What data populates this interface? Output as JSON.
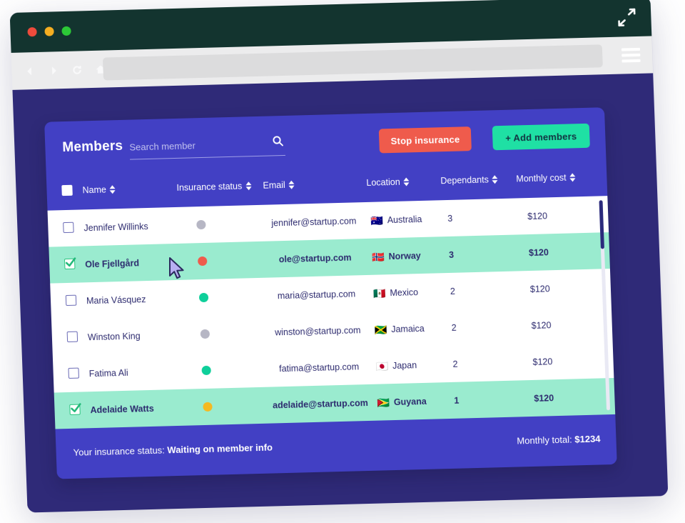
{
  "browser": {
    "traffic_lights": [
      "close-red",
      "minimize-yellow",
      "maximize-green"
    ],
    "expand_icon": "expand-arrows-icon",
    "nav": [
      "back-arrow-icon",
      "forward-arrow-icon",
      "reload-icon",
      "home-icon"
    ],
    "url_value": "",
    "url_placeholder": "",
    "menu_icon": "hamburger-menu-icon"
  },
  "app": {
    "title": "Members",
    "search": {
      "value": "",
      "placeholder": "Search member",
      "icon": "search-icon"
    },
    "buttons": {
      "stop": "Stop insurance",
      "add": "+ Add members"
    },
    "colors": {
      "card": "#4240c4",
      "page_bg": "#2f2a78",
      "titlebar": "#13342f",
      "stop_btn": "#ef5b4c",
      "add_btn": "#1fe0a4",
      "row_selected": "#9aebcf",
      "status_grey": "#b6b6c4",
      "status_red": "#ef5b4c",
      "status_green": "#0ecf9a",
      "status_amber": "#f5b921"
    }
  },
  "table": {
    "columns": [
      {
        "label": "Name",
        "sortable": true
      },
      {
        "label": "Insurance status",
        "sortable": true
      },
      {
        "label": "Email",
        "sortable": true
      },
      {
        "label": "Location",
        "sortable": true
      },
      {
        "label": "Dependants",
        "sortable": true
      },
      {
        "label": "Monthly cost",
        "sortable": true
      }
    ],
    "select_all_checked": true,
    "rows": [
      {
        "selected": false,
        "name": "Jennifer Willinks",
        "status": "grey",
        "email": "jennifer@startup.com",
        "flag": "🇦🇺",
        "location": "Australia",
        "dependants": "3",
        "cost": "$120"
      },
      {
        "selected": true,
        "name": "Ole Fjellgård",
        "status": "red",
        "email": "ole@startup.com",
        "flag": "🇳🇴",
        "location": "Norway",
        "dependants": "3",
        "cost": "$120"
      },
      {
        "selected": false,
        "name": "Maria Vásquez",
        "status": "green",
        "email": "maria@startup.com",
        "flag": "🇲🇽",
        "location": "Mexico",
        "dependants": "2",
        "cost": "$120"
      },
      {
        "selected": false,
        "name": "Winston King",
        "status": "grey",
        "email": "winston@startup.com",
        "flag": "🇯🇲",
        "location": "Jamaica",
        "dependants": "2",
        "cost": "$120"
      },
      {
        "selected": false,
        "name": "Fatima Ali",
        "status": "green",
        "email": "fatima@startup.com",
        "flag": "🇯🇵",
        "location": "Japan",
        "dependants": "2",
        "cost": "$120"
      },
      {
        "selected": true,
        "name": "Adelaide Watts",
        "status": "amber",
        "email": "adelaide@startup.com",
        "flag": "🇬🇾",
        "location": "Guyana",
        "dependants": "1",
        "cost": "$120"
      }
    ]
  },
  "footer": {
    "status_label": "Your insurance status:",
    "status_value": "Waiting on member info",
    "total_label": "Monthly total:",
    "total_value": "$1234"
  }
}
